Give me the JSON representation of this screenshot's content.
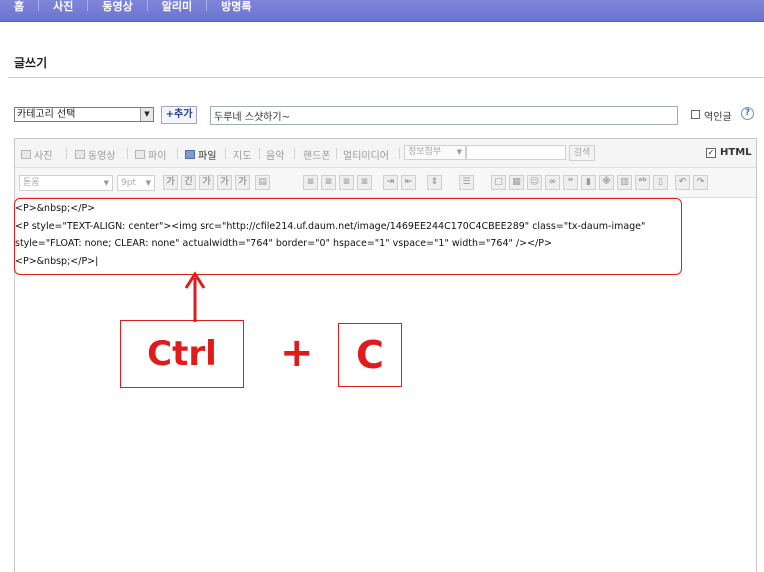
{
  "nav": {
    "items": [
      "홈",
      "사진",
      "동영상",
      "알리미",
      "방명록"
    ]
  },
  "page": {
    "title": "글쓰기"
  },
  "category": {
    "selected": "카테고리 선택",
    "add_label": "+추가"
  },
  "post": {
    "title_value": "두루네 스샷하기~",
    "reverse_label": "역인글",
    "help_icon": "?"
  },
  "toolbar1": {
    "items": [
      "사진",
      "동영상",
      "파이",
      "파일",
      "지도",
      "음악",
      "핸드폰",
      "멀티미디어"
    ],
    "attach_placeholder": "정보첨부",
    "search_label": "검색",
    "html_label": "HTML",
    "html_checked": true
  },
  "toolbar2": {
    "font": "돋움",
    "size": "9pt"
  },
  "editor": {
    "lines": [
      "<P>&nbsp;</P>",
      "<P style=\"TEXT-ALIGN: center\"><img src=\"http://cfile214.uf.daum.net/image/1469EE244C170C4CBEE289\" class=\"tx-daum-image\"",
      "style=\"FLOAT: none; CLEAR: none\" actualwidth=\"764\" border=\"0\" hspace=\"1\" vspace=\"1\" width=\"764\" /></P>",
      "<P>&nbsp;</P>|"
    ]
  },
  "annotation": {
    "ctrl": "Ctrl",
    "plus": "+",
    "c": "C",
    "color": "#e01b1b"
  }
}
